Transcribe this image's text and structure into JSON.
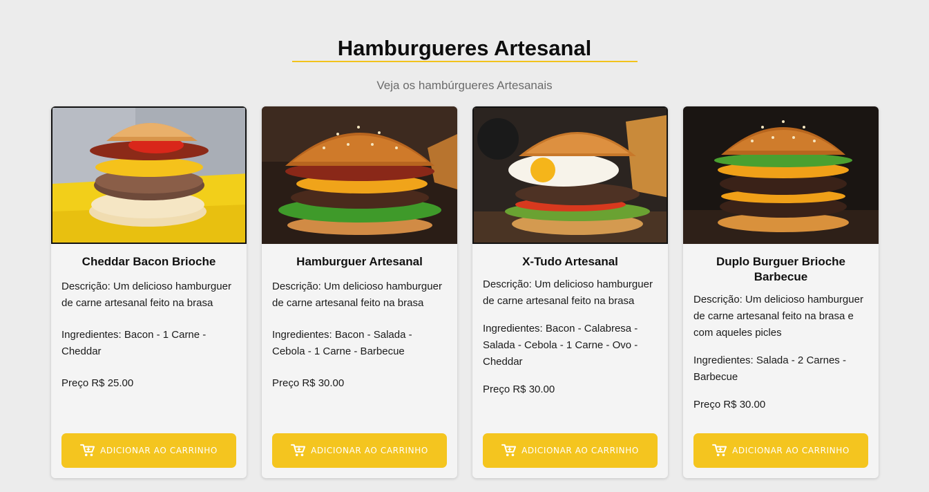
{
  "header": {
    "title": "Hamburgueres Artesanal",
    "subtitle": "Veja os hambúrgueres Artesanais"
  },
  "colors": {
    "accent": "#f4c51f",
    "background": "#ececec",
    "card": "#f4f4f4"
  },
  "products": [
    {
      "name": "Cheddar Bacon Brioche",
      "description": "Descrição: Um delicioso hamburguer de carne artesanal feito na brasa",
      "ingredients": "Ingredientes: Bacon - 1 Carne - Cheddar",
      "price": "Preço R$ 25.00",
      "button_label": "ADICIONAR AO CARRINHO",
      "button_icon": "cart-icon"
    },
    {
      "name": "Hamburguer Artesanal",
      "description": "Descrição: Um delicioso hamburguer de carne artesanal feito na brasa",
      "ingredients": "Ingredientes: Bacon - Salada - Cebola - 1 Carne - Barbecue",
      "price": "Preço R$ 30.00",
      "button_label": "ADICIONAR AO CARRINHO",
      "button_icon": "cart-icon"
    },
    {
      "name": "X-Tudo Artesanal",
      "description": "Descrição: Um delicioso hamburguer de carne artesanal feito na brasa",
      "ingredients": "Ingredientes: Bacon - Calabresa - Salada - Cebola - 1 Carne - Ovo - Cheddar",
      "price": "Preço R$ 30.00",
      "button_label": "ADICIONAR AO CARRINHO",
      "button_icon": "cart-icon"
    },
    {
      "name": "Duplo Burguer Brioche Barbecue",
      "description": "Descrição: Um delicioso hamburguer de carne artesanal feito na brasa e com aqueles picles",
      "ingredients": "Ingredientes: Salada - 2 Carnes - Barbecue",
      "price": "Preço R$ 30.00",
      "button_label": "ADICIONAR AO CARRINHO",
      "button_icon": "cart-icon"
    }
  ]
}
